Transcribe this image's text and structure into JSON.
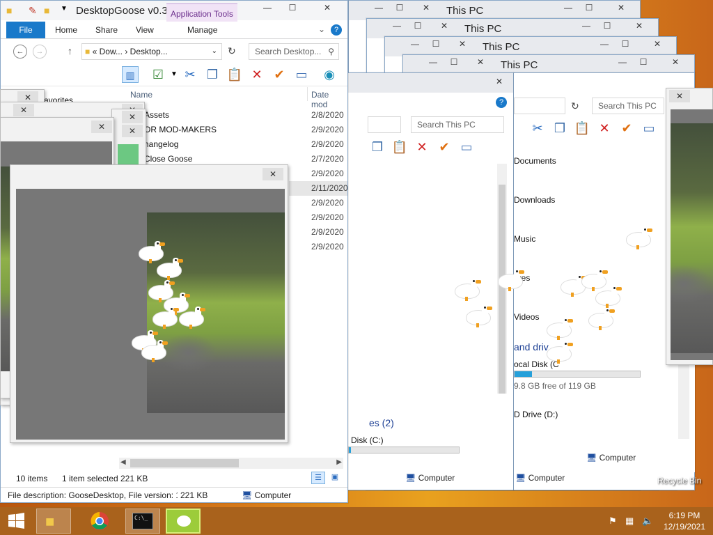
{
  "explorer_main": {
    "title": "DesktopGoose v0.3",
    "contextual_tab": "Application Tools",
    "tabs": [
      "File",
      "Home",
      "Share",
      "View",
      "Manage"
    ],
    "address_parts": [
      "Dow...",
      "Desktop..."
    ],
    "search_placeholder": "Search Desktop...",
    "nav_header": "avorites",
    "col_name": "Name",
    "col_date": "Date mod",
    "files": [
      {
        "name": "Assets",
        "date": "2/8/2020"
      },
      {
        "name": "OR MOD-MAKERS",
        "date": "2/9/2020"
      },
      {
        "name": "hangelog",
        "date": "2/9/2020"
      },
      {
        "name": "Close Goose",
        "date": "2/7/2020"
      },
      {
        "name": "",
        "date": "2/9/2020"
      },
      {
        "name": "",
        "date": "2/11/2020"
      },
      {
        "name": "",
        "date": "2/9/2020"
      },
      {
        "name": "",
        "date": "2/9/2020"
      },
      {
        "name": "",
        "date": "2/9/2020"
      },
      {
        "name": "",
        "date": "2/9/2020"
      }
    ],
    "status_items": "10 items",
    "status_selected": "1 item selected",
    "status_size": "221 KB",
    "details_desc": "File description: GooseDesktop, File version: 1.",
    "details_size": "221 KB",
    "details_location": "Computer"
  },
  "thispc_windows": [
    {
      "title": "This PC"
    },
    {
      "title": "This PC"
    },
    {
      "title": "This PC"
    },
    {
      "title": "This PC"
    }
  ],
  "thispc": {
    "search_placeholder": "Search This PC",
    "folders": [
      "Documents",
      "Downloads",
      "Music",
      "ures",
      "Videos"
    ],
    "drives_header": "and driv",
    "drives_header_short": "es (2)",
    "local_disk": "ocal Disk (C",
    "local_disk_short": "Disk (C:)",
    "free_space": "9.8 GB free of 119 GB",
    "cd_drive": "D Drive (D:)",
    "status_location": "Computer",
    "disk_used_fraction": 0.08
  },
  "desktop": {
    "recycle_bin": "Recycle Bin"
  },
  "taskbar": {
    "time": "6:19 PM",
    "date": "12/19/2021"
  },
  "colors": {
    "accent": "#1979ca",
    "taskbar": "#a9621c",
    "progress": "#26a0da"
  },
  "icons": {
    "close": "✕",
    "minimize": "—",
    "maximize": "☐",
    "help": "?",
    "refresh": "↻",
    "search": "⚲"
  }
}
